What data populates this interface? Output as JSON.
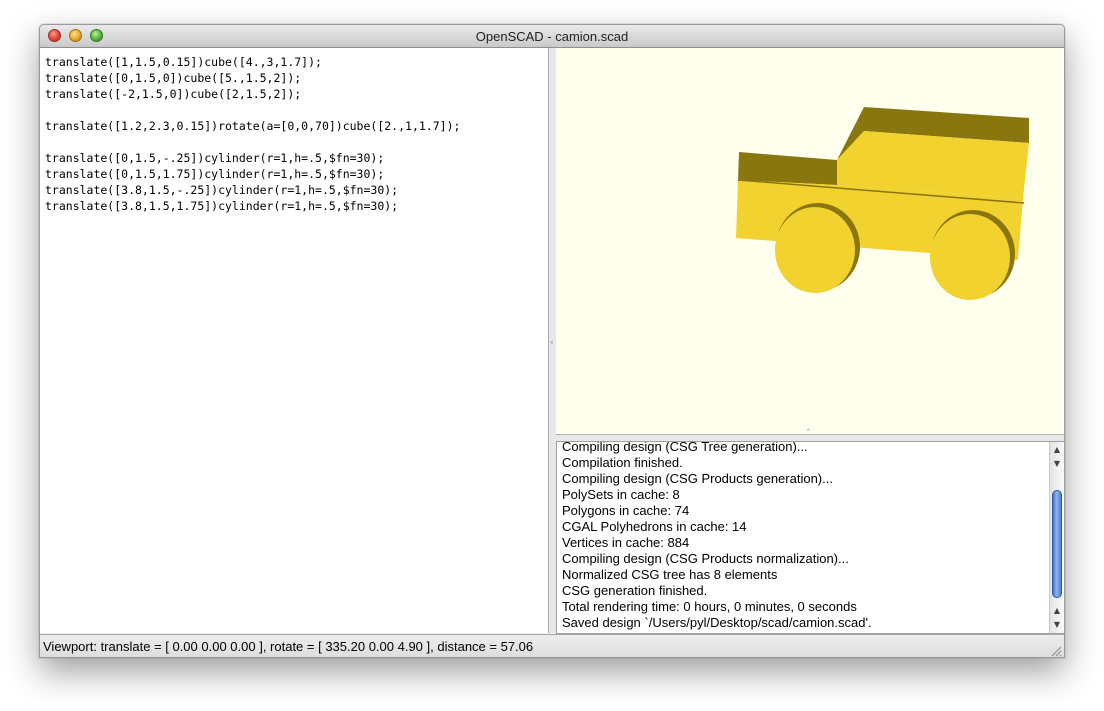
{
  "window": {
    "title": "OpenSCAD - camion.scad"
  },
  "editor": {
    "lines": [
      "translate([1,1.5,0.15])cube([4.,3,1.7]);",
      "translate([0,1.5,0])cube([5.,1.5,2]);",
      "translate([-2,1.5,0])cube([2,1.5,2]);",
      "",
      "translate([1.2,2.3,0.15])rotate(a=[0,0,70])cube([2.,1,1.7]);",
      "",
      "translate([0,1.5,-.25])cylinder(r=1,h=.5,$fn=30);",
      "translate([0,1.5,1.75])cylinder(r=1,h=.5,$fn=30);",
      "translate([3.8,1.5,-.25])cylinder(r=1,h=.5,$fn=30);",
      "translate([3.8,1.5,1.75])cylinder(r=1,h=.5,$fn=30);"
    ]
  },
  "viewport": {
    "background": "#ffffee",
    "model_color": "#f2d22e"
  },
  "console": {
    "lines": [
      "Compiling design (CSG Tree generation)...",
      "Compilation finished.",
      "Compiling design (CSG Products generation)...",
      "PolySets in cache: 8",
      "Polygons in cache: 74",
      "CGAL Polyhedrons in cache: 14",
      "Vertices in cache: 884",
      "Compiling design (CSG Products normalization)...",
      "Normalized CSG tree has 8 elements",
      "CSG generation finished.",
      "Total rendering time: 0 hours, 0 minutes, 0 seconds",
      "Saved design `/Users/pyl/Desktop/scad/camion.scad'."
    ]
  },
  "status": {
    "text": "Viewport: translate = [ 0.00 0.00 0.00 ], rotate = [ 335.20 0.00 4.90 ], distance = 57.06"
  }
}
